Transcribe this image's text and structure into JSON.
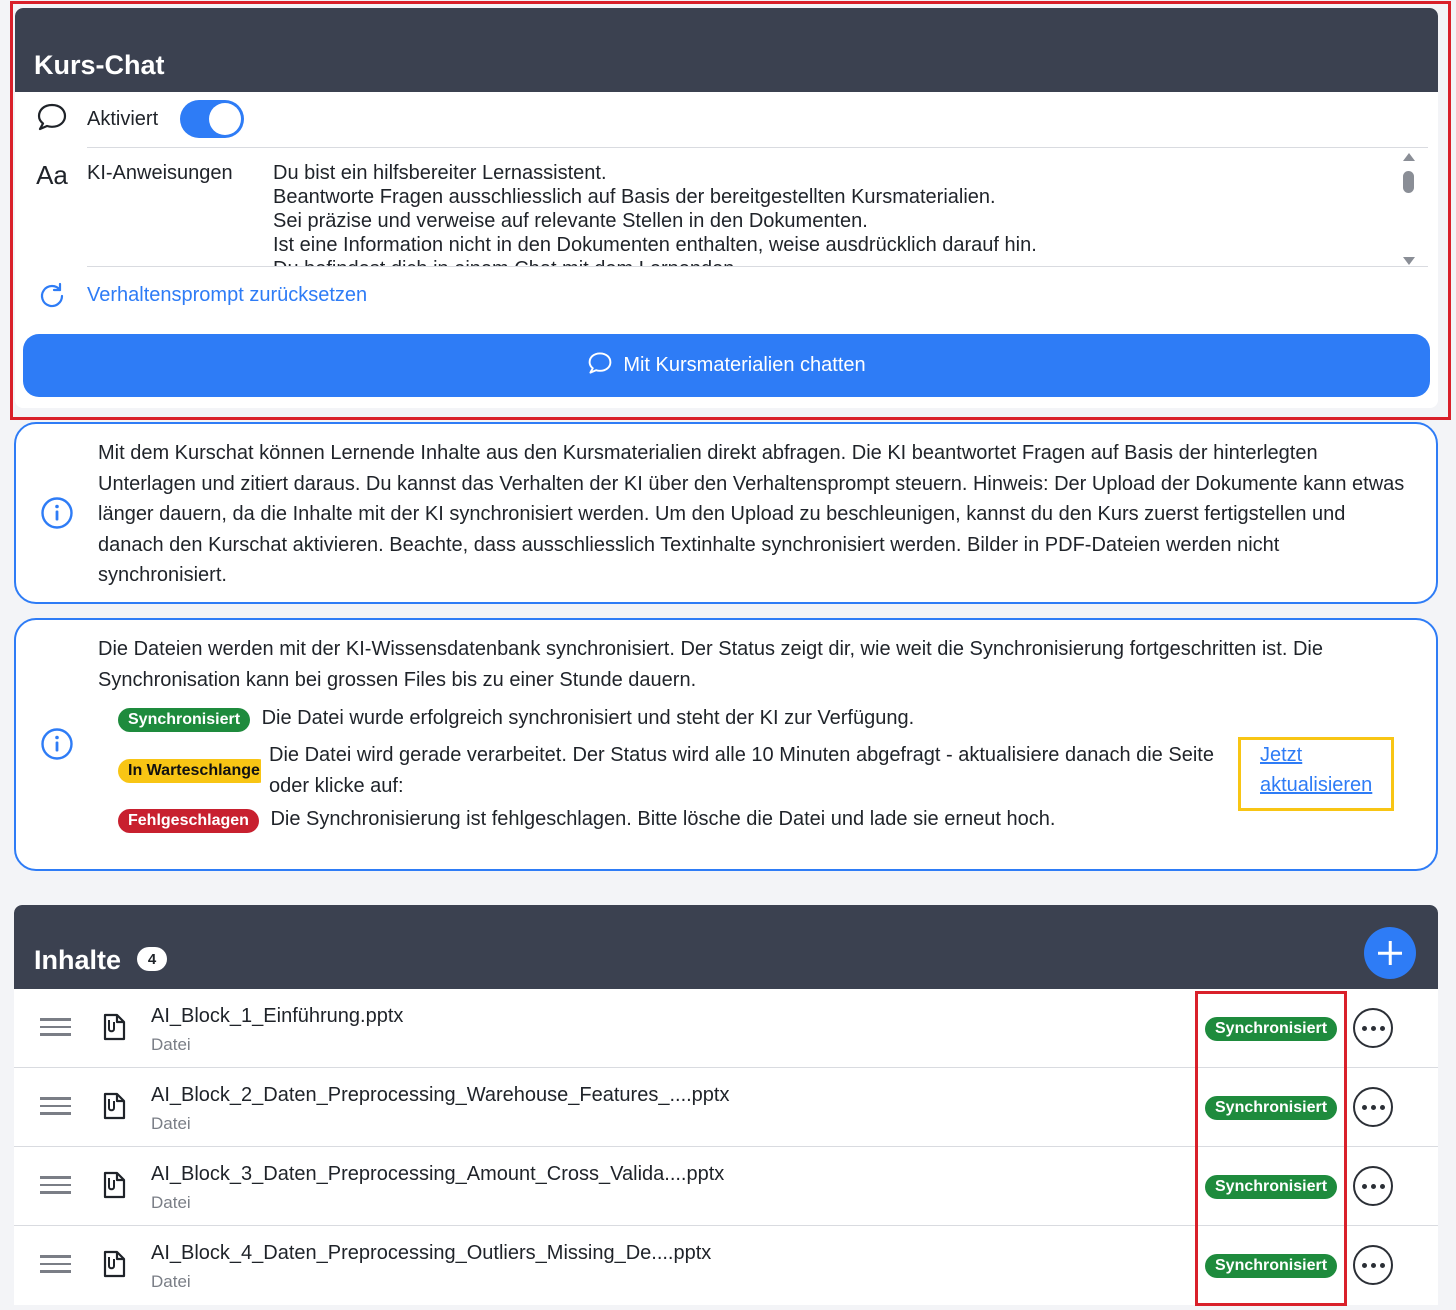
{
  "chat": {
    "title": "Kurs-Chat",
    "activated_label": "Aktiviert",
    "activated": true,
    "instructions_icon": "Aa",
    "instructions_label": "KI-Anweisungen",
    "instructions_text": "Du bist ein hilfsbereiter Lernassistent.\nBeantworte Fragen ausschliesslich auf Basis der bereitgestellten Kursmaterialien.\nSei präzise und verweise auf relevante Stellen in den Dokumenten.\nIst eine Information nicht in den Dokumenten enthalten, weise ausdrücklich darauf hin.\nDu befindest dich in einem Chat mit dem Lernenden.",
    "reset_label": "Verhaltensprompt zurücksetzen",
    "chat_button_label": "Mit Kursmaterialien chatten"
  },
  "info": {
    "text": "Mit dem Kurschat können Lernende Inhalte aus den Kursmaterialien direkt abfragen. Die KI beantwortet Fragen auf Basis der hinterlegten Unterlagen und zitiert daraus. Du kannst das Verhalten der KI über den Verhaltensprompt steuern. Hinweis: Der Upload der Dokumente kann etwas länger dauern, da die Inhalte mit der KI synchronisiert werden. Um den Upload zu beschleunigen, kannst du den Kurs zuerst fertigstellen und danach den Kurschat aktivieren. Beachte, dass ausschliesslich Textinhalte synchronisiert werden. Bilder in PDF-Dateien werden nicht synchronisiert."
  },
  "status_info": {
    "intro": "Die Dateien werden mit der KI-Wissensdatenbank synchronisiert. Der Status zeigt dir, wie weit die Synchronisierung fortgeschritten ist. Die Synchronisation kann bei grossen Files bis zu einer Stunde dauern.",
    "synced_badge": "Synchronisiert",
    "synced_text": "Die Datei wurde erfolgreich synchronisiert und steht der KI zur Verfügung.",
    "queue_badge": "In Warteschlange",
    "queue_text": "Die Datei wird gerade verarbeitet. Der Status wird alle 10 Minuten abgefragt - aktualisiere danach die Seite oder klicke auf:",
    "update_link": "Jetzt aktualisieren",
    "failed_badge": "Fehlgeschlagen",
    "failed_text": "Die Synchronisierung ist fehlgeschlagen. Bitte lösche die Datei und lade sie erneut hoch."
  },
  "contents": {
    "title": "Inhalte",
    "count": "4",
    "items": [
      {
        "name": "AI_Block_1_Einführung.pptx",
        "type": "Datei",
        "status": "Synchronisiert"
      },
      {
        "name": "AI_Block_2_Daten_Preprocessing_Warehouse_Features_....pptx",
        "type": "Datei",
        "status": "Synchronisiert"
      },
      {
        "name": "AI_Block_3_Daten_Preprocessing_Amount_Cross_Valida....pptx",
        "type": "Datei",
        "status": "Synchronisiert"
      },
      {
        "name": "AI_Block_4_Daten_Preprocessing_Outliers_Missing_De....pptx",
        "type": "Datei",
        "status": "Synchronisiert"
      }
    ]
  },
  "colors": {
    "header_bg": "#3b4150",
    "accent": "#2e7cf6",
    "synced": "#1e8b3d",
    "queue": "#f8c514",
    "failed": "#c8202f",
    "highlight_red": "#d9202a",
    "highlight_yellow": "#f8c514"
  },
  "icons": {
    "chat": "chat-bubble-icon",
    "text": "text-format-icon",
    "reset": "refresh-icon",
    "info": "info-icon",
    "file": "file-icon",
    "drag": "drag-handle-icon",
    "more": "more-icon",
    "add": "plus-icon"
  }
}
